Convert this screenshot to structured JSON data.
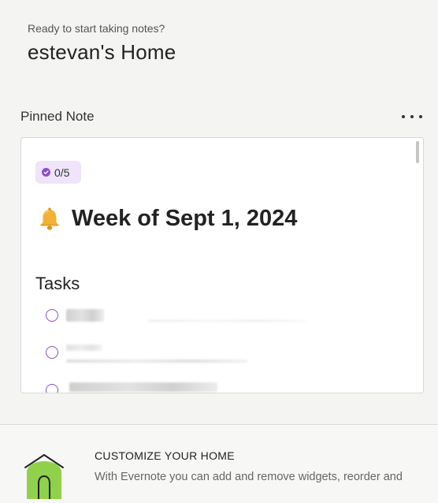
{
  "header": {
    "greeting": "Ready to start taking notes?",
    "title": "estevan's Home"
  },
  "pinned": {
    "section_label": "Pinned Note",
    "more_icon": "more-horizontal-icon",
    "note": {
      "progress_badge": "0/5",
      "title_emoji_icon": "bell-icon",
      "title": "Week of Sept 1, 2024",
      "tasks_heading": "Tasks",
      "accent_color": "#8a4fd0",
      "badge_bg": "#efe4fb"
    }
  },
  "customize": {
    "icon": "house-icon",
    "title": "CUSTOMIZE YOUR HOME",
    "text": "With Evernote you can add and remove widgets, reorder and"
  }
}
